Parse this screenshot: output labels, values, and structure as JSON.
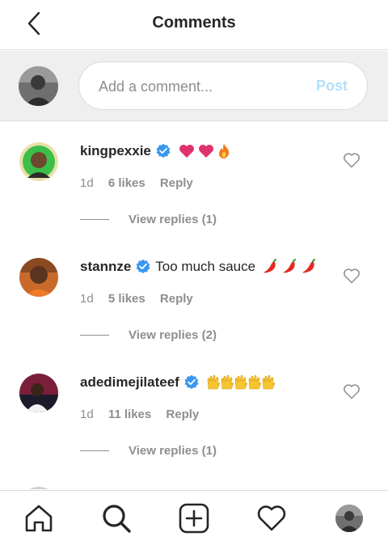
{
  "header": {
    "title": "Comments"
  },
  "compose": {
    "placeholder": "Add a comment...",
    "post_label": "Post"
  },
  "comments": [
    {
      "username": "kingpexxie",
      "text": "",
      "emojis": [
        "heart",
        "heart",
        "fire"
      ],
      "time": "1d",
      "likes": "6 likes",
      "reply": "Reply",
      "view_replies": "View replies (1)"
    },
    {
      "username": "stannze",
      "text": "Too much sauce",
      "emojis": [
        "chili",
        "chili",
        "chili"
      ],
      "time": "1d",
      "likes": "5 likes",
      "reply": "Reply",
      "view_replies": "View replies (2)"
    },
    {
      "username": "adedimejilateef",
      "text": "",
      "emojis": [
        "raised-hands",
        "raised-hands",
        "raised-hands",
        "raised-hands",
        "raised-hands"
      ],
      "time": "1d",
      "likes": "11 likes",
      "reply": "Reply",
      "view_replies": "View replies (1)"
    }
  ],
  "tabbar": {
    "icons": [
      "home-icon",
      "search-icon",
      "add-post-icon",
      "activity-heart-icon",
      "profile-avatar"
    ]
  },
  "colors": {
    "verified": "#3897f0",
    "heart_emoji": "#e0336d",
    "post_disabled": "#b2dffc",
    "muted": "#8e8e8e"
  }
}
